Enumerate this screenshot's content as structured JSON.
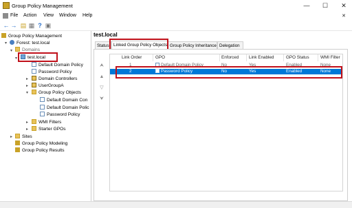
{
  "window": {
    "title": "Group Policy Management",
    "minimize": "—",
    "maximize": "☐",
    "close": "✕"
  },
  "menu": [
    "File",
    "Action",
    "View",
    "Window",
    "Help"
  ],
  "toolbar": {
    "back": "←",
    "forward": "→",
    "up": "▤",
    "properties": "▦",
    "help": "?",
    "console": "▣"
  },
  "tree": {
    "root": "Group Policy Management",
    "forest": "Forest: test.local",
    "domains": "Domains",
    "domain": "test.local",
    "children": [
      "Default Domain Policy",
      "Password Policy",
      "Domain Controllers",
      "UserGroupA",
      "Group Policy Objects"
    ],
    "gpo_children": [
      "Default Domain Con",
      "Default Domain Polic",
      "Password Policy"
    ],
    "more": [
      "WMI Filters",
      "Starter GPOs"
    ],
    "sites": "Sites",
    "modeling": "Group Policy Modeling",
    "results": "Group Policy Results"
  },
  "right": {
    "domain_title": "test.local",
    "tabs": [
      "Status",
      "Linked Group Policy Objects",
      "Group Policy Inheritance",
      "Delegation"
    ],
    "columns": [
      "Link Order",
      "GPO",
      "Enforced",
      "Link Enabled",
      "GPO Status",
      "WMI Filter"
    ],
    "rows": [
      [
        "1",
        "Default Domain Policy",
        "No",
        "Yes",
        "Enabled",
        "None"
      ],
      [
        "2",
        "Password Policy",
        "No",
        "Yes",
        "Enabled",
        "None"
      ]
    ],
    "side_buttons": [
      "⮝",
      "▲",
      "▽",
      "⮟"
    ]
  },
  "colors": {
    "selection": "#0078d7",
    "highlight": "#c0101a"
  }
}
